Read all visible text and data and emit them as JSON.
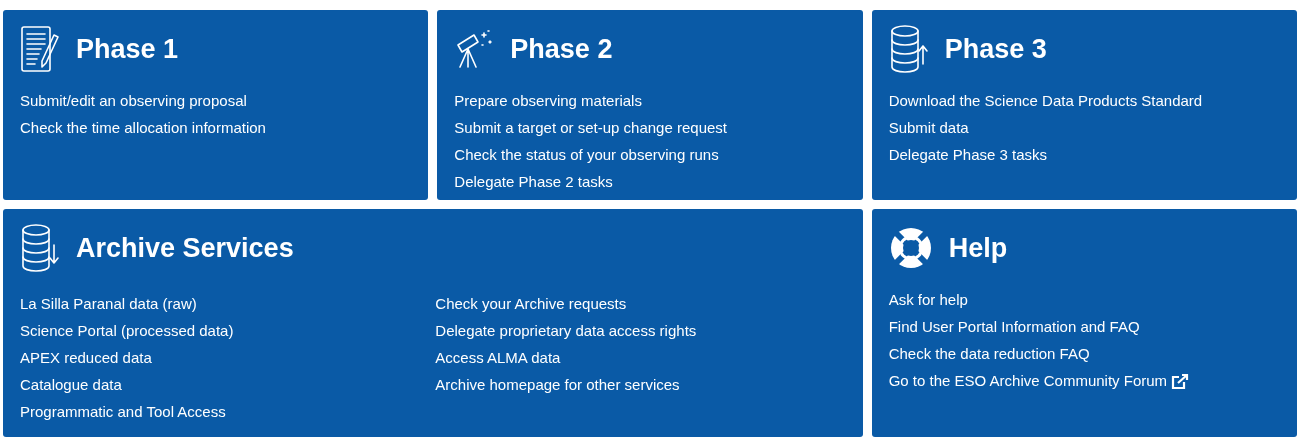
{
  "cards": [
    {
      "title": "Phase 1",
      "columns": [
        [
          {
            "text": "Submit/edit an observing proposal",
            "external": false
          },
          {
            "text": "Check the time allocation information",
            "external": false
          }
        ]
      ]
    },
    {
      "title": "Phase 2",
      "columns": [
        [
          {
            "text": "Prepare observing materials",
            "external": false
          },
          {
            "text": "Submit a target or set-up change request",
            "external": false
          },
          {
            "text": "Check the status of your observing runs",
            "external": false
          },
          {
            "text": "Delegate Phase 2 tasks",
            "external": false
          }
        ]
      ]
    },
    {
      "title": "Phase 3",
      "columns": [
        [
          {
            "text": "Download the Science Data Products Standard",
            "external": false
          },
          {
            "text": "Submit data",
            "external": false
          },
          {
            "text": "Delegate Phase 3 tasks",
            "external": false
          }
        ]
      ]
    },
    {
      "title": "Archive Services",
      "columns": [
        [
          {
            "text": "La Silla Paranal data (raw)",
            "external": false
          },
          {
            "text": "Science Portal (processed data)",
            "external": false
          },
          {
            "text": "APEX reduced data",
            "external": false
          },
          {
            "text": "Catalogue data",
            "external": false
          },
          {
            "text": "Programmatic and Tool Access",
            "external": false
          }
        ],
        [
          {
            "text": "Check your Archive requests",
            "external": false
          },
          {
            "text": "Delegate proprietary data access rights",
            "external": false
          },
          {
            "text": "Access ALMA data",
            "external": false
          },
          {
            "text": "Archive homepage for other services",
            "external": false
          }
        ]
      ]
    },
    {
      "title": "Help",
      "columns": [
        [
          {
            "text": "Ask for help",
            "external": false
          },
          {
            "text": "Find User Portal Information and FAQ",
            "external": false
          },
          {
            "text": "Check the data reduction FAQ",
            "external": false
          },
          {
            "text": "Go to the ESO Archive Community Forum",
            "external": true
          }
        ]
      ]
    }
  ]
}
